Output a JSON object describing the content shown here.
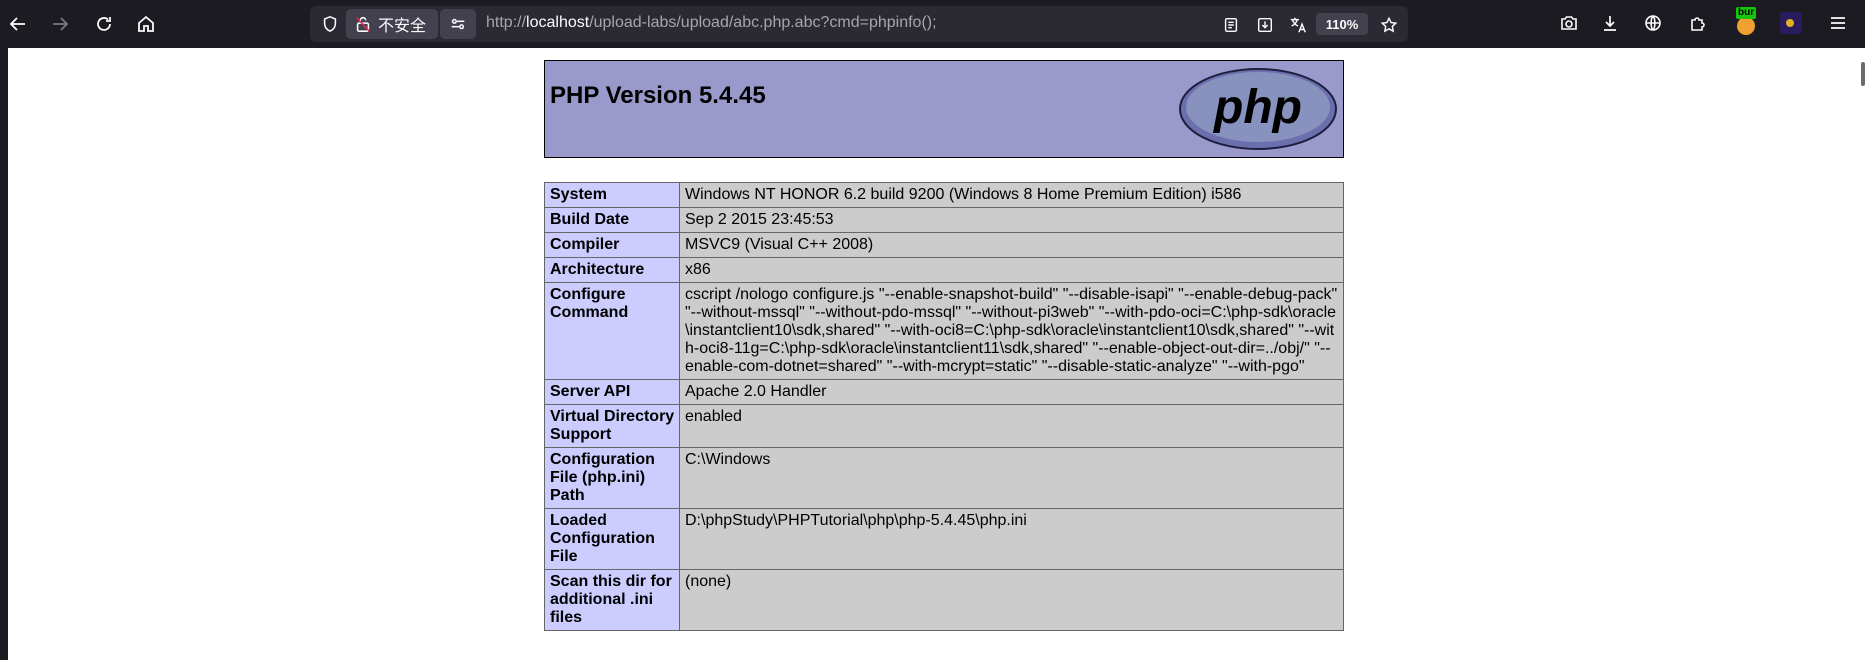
{
  "browser": {
    "url_prefix": "http://",
    "url_host": "localhost",
    "url_path": "/upload-labs/upload/abc.php.abc?cmd=phpinfo();",
    "security_label": "不安全",
    "zoom": "110%",
    "burp_badge": "bur",
    "icons": {
      "back": "arrow-left-icon",
      "forward": "arrow-right-icon",
      "reload": "reload-icon",
      "home": "home-icon",
      "tracking": "shield-icon",
      "insecure": "lock-broken-icon",
      "permissions": "permissions-icon",
      "reader": "reader-view-icon",
      "save": "save-page-icon",
      "translate": "translate-icon",
      "bookmark": "star-icon",
      "screenshot": "camera-icon",
      "downloads": "download-icon",
      "vpn": "globe-icon",
      "extensions": "puzzle-icon",
      "menu": "hamburger-icon"
    },
    "colors": {
      "toolbar": "#1c1b22",
      "urlbar": "#2b2a33",
      "chip": "#42414d"
    }
  },
  "phpinfo": {
    "title": "PHP Version 5.4.45",
    "logo_text": "php",
    "colors": {
      "header": "#9999cc",
      "key": "#ccccff",
      "value": "#cccccc"
    },
    "rows": [
      {
        "key": "System",
        "value": "Windows NT HONOR 6.2 build 9200 (Windows 8 Home Premium Edition) i586"
      },
      {
        "key": "Build Date",
        "value": "Sep 2 2015 23:45:53"
      },
      {
        "key": "Compiler",
        "value": "MSVC9 (Visual C++ 2008)"
      },
      {
        "key": "Architecture",
        "value": "x86"
      },
      {
        "key": "Configure Command",
        "value": "cscript /nologo configure.js \"--enable-snapshot-build\" \"--disable-isapi\" \"--enable-debug-pack\" \"--without-mssql\" \"--without-pdo-mssql\" \"--without-pi3web\" \"--with-pdo-oci=C:\\php-sdk\\oracle\\instantclient10\\sdk,shared\" \"--with-oci8=C:\\php-sdk\\oracle\\instantclient10\\sdk,shared\" \"--with-oci8-11g=C:\\php-sdk\\oracle\\instantclient11\\sdk,shared\" \"--enable-object-out-dir=../obj/\" \"--enable-com-dotnet=shared\" \"--with-mcrypt=static\" \"--disable-static-analyze\" \"--with-pgo\""
      },
      {
        "key": "Server API",
        "value": "Apache 2.0 Handler"
      },
      {
        "key": "Virtual Directory Support",
        "value": "enabled"
      },
      {
        "key": "Configuration File (php.ini) Path",
        "value": "C:\\Windows"
      },
      {
        "key": "Loaded Configuration File",
        "value": "D:\\phpStudy\\PHPTutorial\\php\\php-5.4.45\\php.ini"
      },
      {
        "key": "Scan this dir for additional .ini files",
        "value": "(none)"
      }
    ]
  }
}
